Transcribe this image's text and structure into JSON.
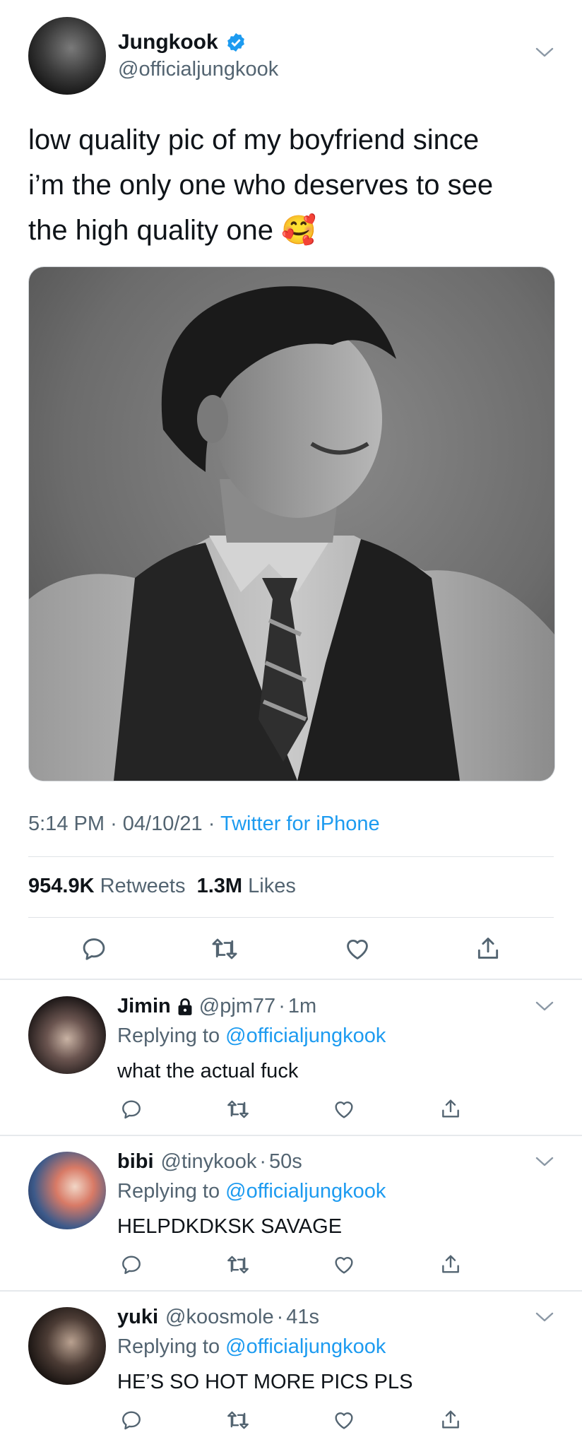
{
  "tweet": {
    "author_name": "Jungkook",
    "author_handle": "@officialjungkook",
    "text_line1": "low quality pic of my boyfriend since",
    "text_line2": "i’m the only one who deserves to see",
    "text_line3": "the high quality one",
    "emoji": "🥰",
    "time": "5:14 PM",
    "date": "04/10/21",
    "source": "Twitter for iPhone",
    "retweets_count": "954.9K",
    "retweets_label": "Retweets",
    "likes_count": "1.3M",
    "likes_label": "Likes"
  },
  "replies": [
    {
      "name": "Jimin",
      "handle": "@pjm77",
      "time": "1m",
      "replying_prefix": "Replying to",
      "replying_to": "@officialjungkook",
      "text": "what the actual fuck"
    },
    {
      "name": "bibi",
      "handle": "@tinykook",
      "time": "50s",
      "replying_prefix": "Replying to",
      "replying_to": "@officialjungkook",
      "text": "HELPDKDKSK SAVAGE"
    },
    {
      "name": "yuki",
      "handle": "@koosmole",
      "time": "41s",
      "replying_prefix": "Replying to",
      "replying_to": "@officialjungkook",
      "text": "HE’S SO HOT MORE PICS PLS"
    }
  ],
  "separator": "·",
  "icons": {
    "verified": "verified-badge-icon",
    "lock": "lock-icon",
    "chevron": "chevron-down-icon",
    "reply": "reply-icon",
    "retweet": "retweet-icon",
    "like": "heart-icon",
    "share": "share-icon"
  },
  "colors": {
    "accent": "#1d9bf0",
    "secondary_text": "#536471",
    "primary_text": "#0f1419"
  }
}
